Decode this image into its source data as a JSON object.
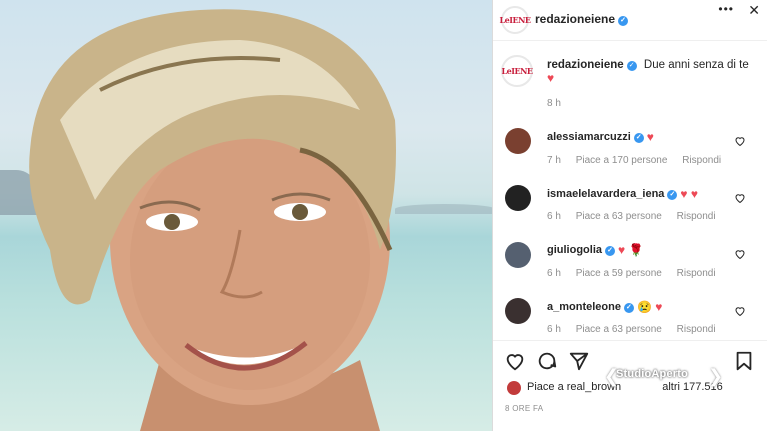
{
  "header": {
    "username": "redazioneiene",
    "more_label": "•••",
    "close_label": "✕"
  },
  "post": {
    "username": "redazioneiene",
    "caption": "Due anni senza di te",
    "caption_emoji": "♥",
    "age": "8 h"
  },
  "logo_text": "LeIENE",
  "comments": [
    {
      "username": "alessiamarcuzzi",
      "emoji": "♥",
      "time": "7 h",
      "likes": "Piace a 170 persone",
      "reply": "Rispondi"
    },
    {
      "username": "ismaelelavardera_iena",
      "emoji": "♥ ♥",
      "time": "6 h",
      "likes": "Piace a 63 persone",
      "reply": "Rispondi"
    },
    {
      "username": "giuliogolia",
      "emoji": "♥ 🌹",
      "time": "6 h",
      "likes": "Piace a 59 persone",
      "reply": "Rispondi"
    },
    {
      "username": "a_monteleone",
      "emoji": "😢 ♥",
      "time": "6 h",
      "likes": "Piace a 63 persone",
      "reply": "Rispondi"
    }
  ],
  "footer": {
    "likes_text": "Piace a real_brown",
    "likes_suffix": "altri 177.516",
    "posted": "8 ORE FA"
  },
  "watermark": "StudioAperto",
  "colors": {
    "verified": "#3897f0",
    "heart": "#ed4956",
    "brand": "#c81e3c"
  }
}
